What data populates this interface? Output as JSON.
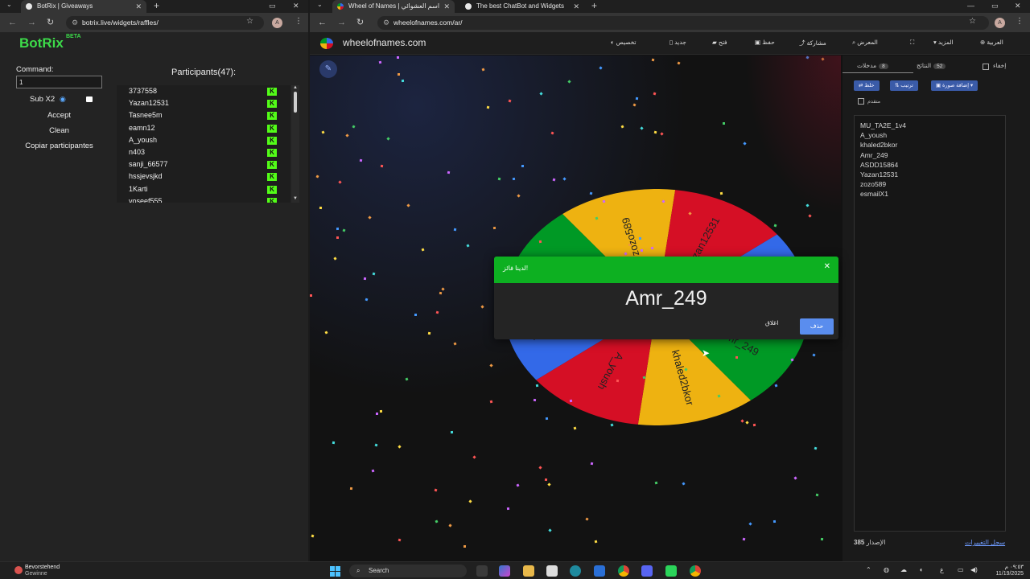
{
  "left_window": {
    "tab_title": "BotRix | Giveaways",
    "url": "botrix.live/widgets/raffles/",
    "avatar": "A"
  },
  "botrix": {
    "logo": "BotRix",
    "beta": "BETA",
    "command_label": "Command:",
    "command_value": "1",
    "sub_x2_label": "Sub X2",
    "accept_label": "Accept",
    "clean_label": "Clean",
    "copy_label": "Copiar participantes",
    "participants_title": "Participants(47):",
    "participants": [
      "3737558",
      "Yazan12531",
      "Tasnee5m",
      "eamn12",
      "A_yoush",
      "n403",
      "sanji_66577",
      "hssjevsjkd",
      "1Karti",
      "yoseef555"
    ],
    "kick_glyph": "K"
  },
  "right_window": {
    "tab1_title": "Wheel of Names | اسم العشوائي",
    "tab2_title": "The best ChatBot and Widgets",
    "url": "wheelofnames.com/ar/",
    "avatar": "A"
  },
  "wheel_site": {
    "logo": "wheelofnames.com",
    "menu": [
      "تخصيص",
      "جديد",
      "فتح",
      "حفظ",
      "مشاركة",
      "المعرض",
      "المزيد",
      "العربية"
    ],
    "tabs": {
      "entries_label": "مدخلات",
      "entries_count": "8",
      "results_label": "النتائج",
      "results_count": "52",
      "hide_label": "إخفاء"
    },
    "buttons": {
      "shuffle": "خلط",
      "sort": "ترتيب",
      "add_image": "إضافة صورة"
    },
    "advanced_label": "متقدم",
    "entries": [
      "MU_TA2E_1v4",
      "A_yoush",
      "khaled2bkor",
      "Amr_249",
      "ASDD15864",
      "Yazan12531",
      "zozo589",
      "esmailX1"
    ],
    "footer_version_label": "الإصدار",
    "footer_version": "385",
    "footer_changelog": "سجل التغييرات",
    "wheel_segments": [
      {
        "label": "zozo589",
        "color": "#eeb211"
      },
      {
        "label": "Yazan12531",
        "color": "#d50f25"
      },
      {
        "label": "ASDD15864",
        "color": "#3369e8"
      },
      {
        "label": "Amr_249",
        "color": "#009925"
      },
      {
        "label": "khaled2bkor",
        "color": "#eeb211"
      },
      {
        "label": "A_yoush",
        "color": "#d50f25"
      },
      {
        "label": "MU_TA2E_1v4",
        "color": "#3369e8"
      },
      {
        "label": "esmailX1",
        "color": "#009925"
      }
    ]
  },
  "dialog": {
    "title": "لدينا فائز!",
    "winner": "Amr_249",
    "close_label": "اغلاق",
    "remove_label": "حذف"
  },
  "taskbar": {
    "weather_title": "Bevorstehend",
    "weather_sub": "Gewinne",
    "weather_badge": "4",
    "search_label": "Search",
    "lang": "ع",
    "time": "٠٩:٥٣ م",
    "date": "11/19/2025"
  }
}
